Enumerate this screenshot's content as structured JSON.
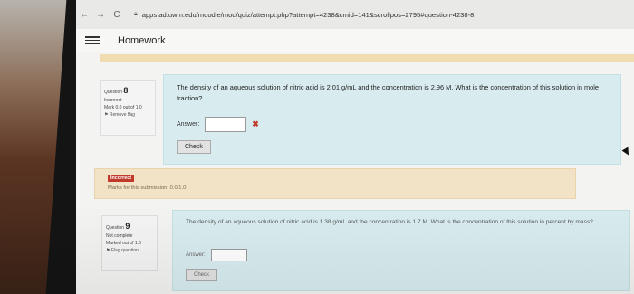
{
  "browser": {
    "url": "apps.ad.uwm.edu/moodle/mod/quiz/attempt.php?attempt=4238&cmid=141&scrollpos=2795#question-4238-8",
    "nav": {
      "back": "←",
      "forward": "→",
      "reload": "C"
    },
    "lock_icon": "lock-icon"
  },
  "header": {
    "title": "Homework",
    "menu_icon": "hamburger-icon"
  },
  "question8": {
    "label": "Question",
    "number": "8",
    "status": "Incorrect",
    "mark": "Mark 0.0 out of 1.0",
    "flag": "Remove flag",
    "text": "The density of an aqueous solution of nitric acid is 2.01 g/mL and the concentration is 2.96 M. What is the concentration of this solution in mole fraction?",
    "answer_label": "Answer:",
    "answer_value": "",
    "result_icon": "x-icon",
    "check_label": "Check",
    "feedback": {
      "badge": "Incorrect",
      "marks": "Marks for this submission: 0.0/1.0."
    }
  },
  "question9": {
    "label": "Question",
    "number": "9",
    "status": "Not complete",
    "mark": "Marked out of 1.0",
    "flag": "Flag question",
    "text": "The density of an aqueous solution of nitric acid is 1.38 g/mL and the concentration is 1.7 M. What is the concentration of this solution in percent by mass?",
    "answer_label": "Answer:",
    "answer_value": "",
    "check_label": "Check"
  },
  "colors": {
    "question_bg": "#d8ecef",
    "feedback_bg": "#f2e3c6",
    "incorrect": "#c0392b"
  }
}
